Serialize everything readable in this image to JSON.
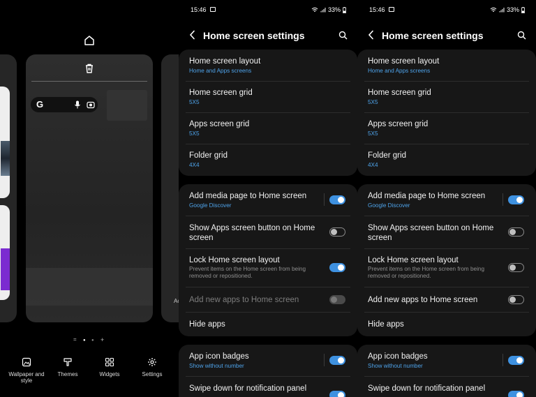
{
  "home_edit": {
    "search_widget_logo": "G",
    "right_card_partial_text": "Ac",
    "page_indicator": [
      "=",
      "●",
      "●",
      "+"
    ],
    "options": [
      {
        "label": "Wallpaper and style",
        "icon": "wallpaper-icon"
      },
      {
        "label": "Themes",
        "icon": "themes-icon"
      },
      {
        "label": "Widgets",
        "icon": "widgets-icon"
      },
      {
        "label": "Settings",
        "icon": "gear-icon"
      }
    ]
  },
  "status_bar": {
    "time": "15:46",
    "battery": "33%"
  },
  "settings_left": {
    "title": "Home screen settings",
    "group1": [
      {
        "title": "Home screen layout",
        "subtitle": "Home and Apps screens"
      },
      {
        "title": "Home screen grid",
        "subtitle": "5X5"
      },
      {
        "title": "Apps screen grid",
        "subtitle": "5X5"
      },
      {
        "title": "Folder grid",
        "subtitle": "4X4"
      }
    ],
    "group2": [
      {
        "title": "Add media page to Home screen",
        "subtitle": "Google Discover",
        "toggle": "on"
      },
      {
        "title": "Show Apps screen button on Home screen",
        "toggle": "off"
      },
      {
        "title": "Lock Home screen layout",
        "description": "Prevent items on the Home screen from being removed or repositioned.",
        "toggle": "on"
      },
      {
        "title": "Add new apps to Home screen",
        "toggle": "disabled"
      },
      {
        "title": "Hide apps"
      }
    ],
    "group3": [
      {
        "title": "App icon badges",
        "subtitle": "Show without number",
        "toggle": "on"
      },
      {
        "title": "Swipe down for notification panel",
        "toggle": "on"
      }
    ]
  },
  "settings_right": {
    "title": "Home screen settings",
    "group1": [
      {
        "title": "Home screen layout",
        "subtitle": "Home and Apps screens"
      },
      {
        "title": "Home screen grid",
        "subtitle": "5X5"
      },
      {
        "title": "Apps screen grid",
        "subtitle": "5X5"
      },
      {
        "title": "Folder grid",
        "subtitle": "4X4"
      }
    ],
    "group2": [
      {
        "title": "Add media page to Home screen",
        "subtitle": "Google Discover",
        "toggle": "on"
      },
      {
        "title": "Show Apps screen button on Home screen",
        "toggle": "off"
      },
      {
        "title": "Lock Home screen layout",
        "description": "Prevent items on the Home screen from being removed or repositioned.",
        "toggle": "off"
      },
      {
        "title": "Add new apps to Home screen",
        "toggle": "off"
      },
      {
        "title": "Hide apps"
      }
    ],
    "group3": [
      {
        "title": "App icon badges",
        "subtitle": "Show without number",
        "toggle": "on"
      },
      {
        "title": "Swipe down for notification panel",
        "toggle": "on"
      }
    ]
  },
  "colors": {
    "accent": "#3e91e0",
    "subtitle": "#4ea3ea",
    "card": "#171717",
    "background": "#000000"
  }
}
